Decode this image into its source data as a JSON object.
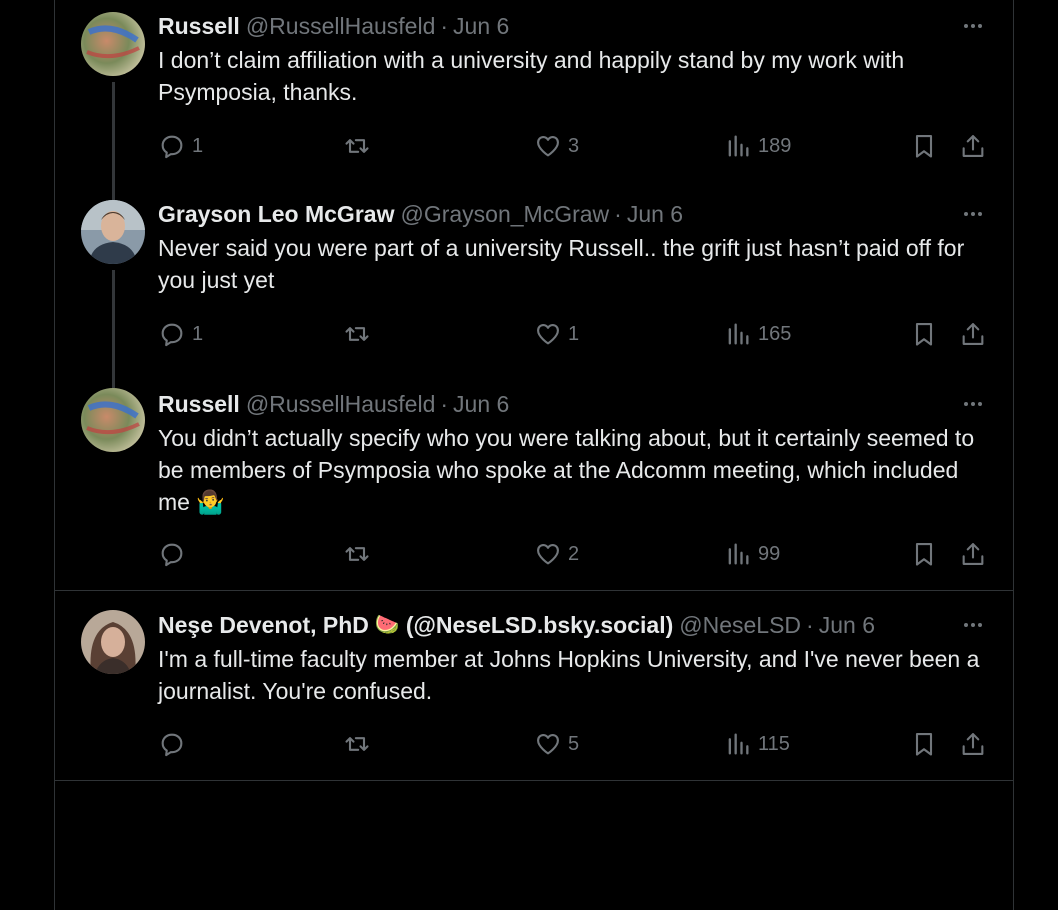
{
  "tweets": [
    {
      "name": "Russell",
      "handle": "@RussellHausfeld",
      "dot": "·",
      "date": "Jun 6",
      "text": "I don’t claim affiliation with a university and happily stand by my work with Psymposia, thanks.",
      "replies": "1",
      "retweets": "",
      "likes": "3",
      "views": "189"
    },
    {
      "name": "Grayson Leo McGraw",
      "handle": "@Grayson_McGraw",
      "dot": "·",
      "date": "Jun 6",
      "text": "Never said you were part of a university Russell.. the grift just hasn’t paid off for you just yet",
      "replies": "1",
      "retweets": "",
      "likes": "1",
      "views": "165"
    },
    {
      "name": "Russell",
      "handle": "@RussellHausfeld",
      "dot": "·",
      "date": "Jun 6",
      "text": "You didn’t actually specify who you were talking about, but it certainly seemed to be members of Psymposia who spoke at the Adcomm meeting, which included me",
      "emoji": "🤷‍♂️",
      "replies": "",
      "retweets": "",
      "likes": "2",
      "views": "99"
    },
    {
      "name": "Neşe Devenot, PhD",
      "name_emoji": "🍉",
      "name_suffix": "(@NeseLSD.bsky.social)",
      "handle": "@NeseLSD",
      "dot": "·",
      "date": "Jun 6",
      "text": "I'm a full-time faculty member at Johns Hopkins University, and I've never been a journalist. You're confused.",
      "replies": "",
      "retweets": "",
      "likes": "5",
      "views": "115"
    }
  ],
  "icons": {
    "more": "more-icon",
    "reply": "reply-icon",
    "retweet": "retweet-icon",
    "like": "heart-icon",
    "views": "views-icon",
    "bookmark": "bookmark-icon",
    "share": "share-icon"
  },
  "colors": {
    "background": "#000000",
    "text": "#e7e9ea",
    "secondary": "#71767b",
    "border": "#2f3336"
  }
}
